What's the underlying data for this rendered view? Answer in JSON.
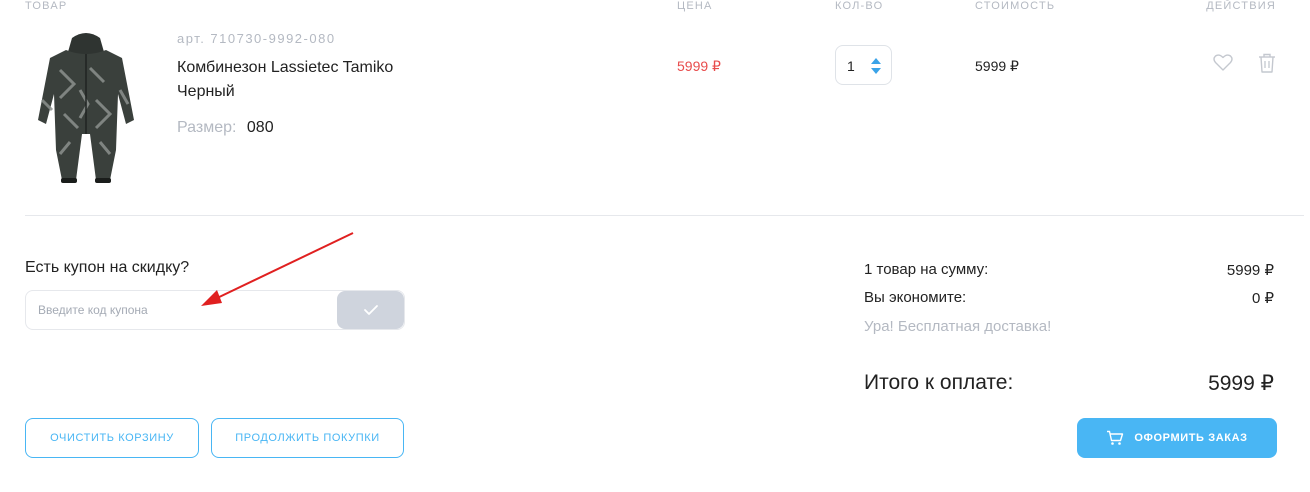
{
  "table_header": {
    "product": "ТОВАР",
    "price": "ЦЕНА",
    "quantity": "КОЛ-ВО",
    "cost": "СТОИМОСТЬ",
    "actions": "ДЕЙСТВИЯ"
  },
  "item": {
    "sku": "арт. 710730-9992-080",
    "name": "Комбинезон Lassietec Tamiko Черный",
    "size_label": "Размер:",
    "size_value": "080",
    "price": "5999 ₽",
    "quantity": "1",
    "cost": "5999 ₽",
    "image_icon": "snowsuit-image"
  },
  "coupon": {
    "title": "Есть купон на скидку?",
    "placeholder": "Введите код купона",
    "value": "",
    "submit_icon": "checkmark-icon"
  },
  "summary": {
    "items_label": "1 товар на сумму:",
    "items_value": "5999 ₽",
    "savings_label": "Вы экономите:",
    "savings_value": "0 ₽",
    "shipping_note": "Ура! Бесплатная доставка!",
    "total_label": "Итого к оплате:",
    "total_value": "5999 ₽"
  },
  "buttons": {
    "clear_cart": "ОЧИСТИТЬ КОРЗИНУ",
    "continue_shopping": "ПРОДОЛЖИТЬ ПОКУПКИ",
    "checkout": "ОФОРМИТЬ ЗАКАЗ"
  },
  "colors": {
    "accent": "#49b6f4",
    "sale_price": "#e84c4c",
    "muted_text": "#b4b9c2",
    "annotation_arrow": "#e02020"
  }
}
